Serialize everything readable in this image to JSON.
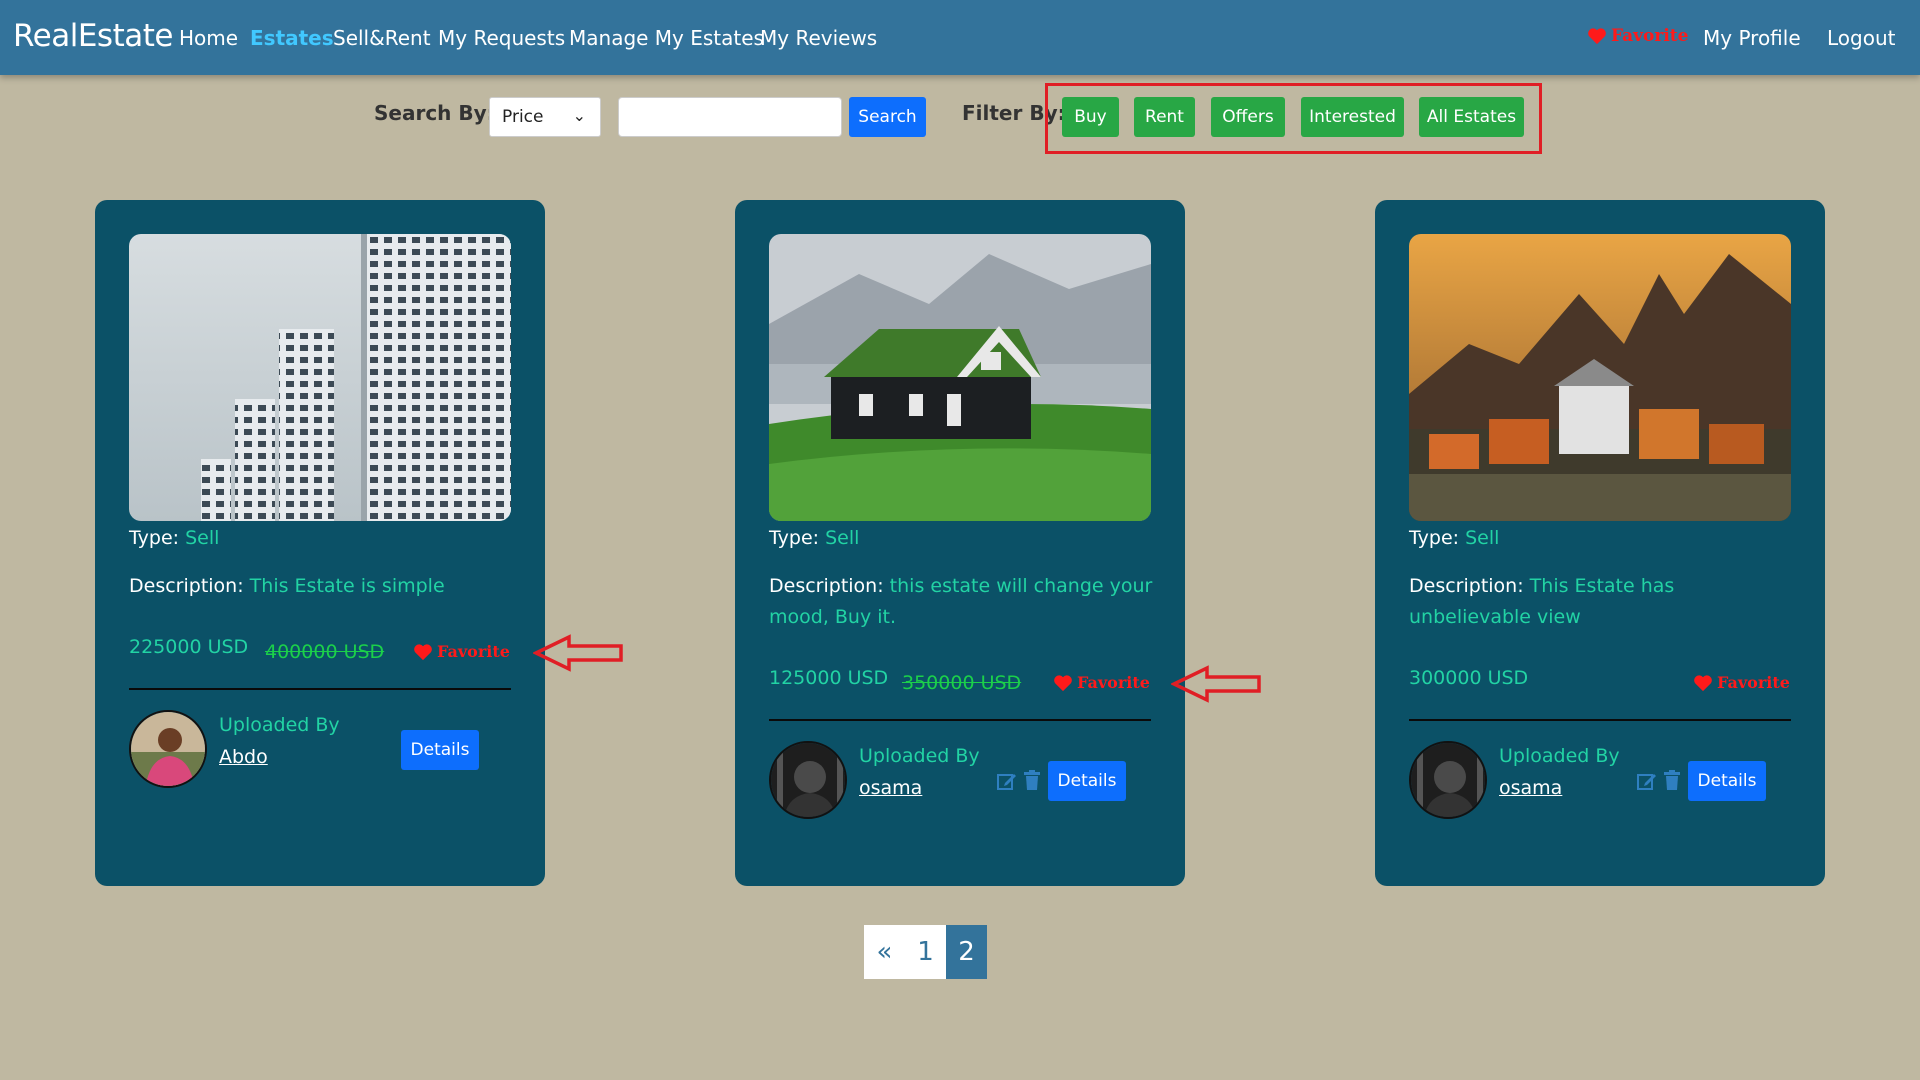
{
  "nav": {
    "brand": "RealEstate",
    "links": [
      "Home",
      "Estates",
      "Sell&Rent",
      "My Requests",
      "Manage My Estates",
      "My Reviews"
    ],
    "favorite": "Favorite",
    "profile": "My Profile",
    "logout": "Logout"
  },
  "search": {
    "label": "Search By:",
    "select_value": "Price",
    "input_value": "",
    "button": "Search"
  },
  "filter": {
    "label": "Filter By:",
    "buttons": [
      "Buy",
      "Rent",
      "Offers",
      "Interested",
      "All Estates"
    ]
  },
  "cards": [
    {
      "type_label": "Type:",
      "type": "Sell",
      "desc_label": "Description:",
      "description": "This Estate is simple",
      "price": "225000 USD",
      "old_price": "400000 USD",
      "favorite": "Favorite",
      "uploaded_by": "Uploaded By",
      "uploader": "Abdo",
      "details": "Details"
    },
    {
      "type_label": "Type:",
      "type": "Sell",
      "desc_label": "Description:",
      "description": "this estate will change your mood, Buy it.",
      "price": "125000 USD",
      "old_price": "350000 USD",
      "favorite": "Favorite",
      "uploaded_by": "Uploaded By",
      "uploader": "osama",
      "details": "Details"
    },
    {
      "type_label": "Type:",
      "type": "Sell",
      "desc_label": "Description:",
      "description": "This Estate has unbelievable view",
      "price": "300000 USD",
      "favorite": "Favorite",
      "uploaded_by": "Uploaded By",
      "uploader": "osama",
      "details": "Details"
    }
  ],
  "pagination": {
    "prev": "«",
    "pages": [
      "1",
      "2"
    ],
    "current": "2"
  },
  "colors": {
    "navbar": "#33739b",
    "background": "#bfb8a1",
    "card": "#0b5167",
    "accent_green": "#28a745",
    "accent_blue": "#0d6efd",
    "favorite_red": "#ff1a1a"
  }
}
